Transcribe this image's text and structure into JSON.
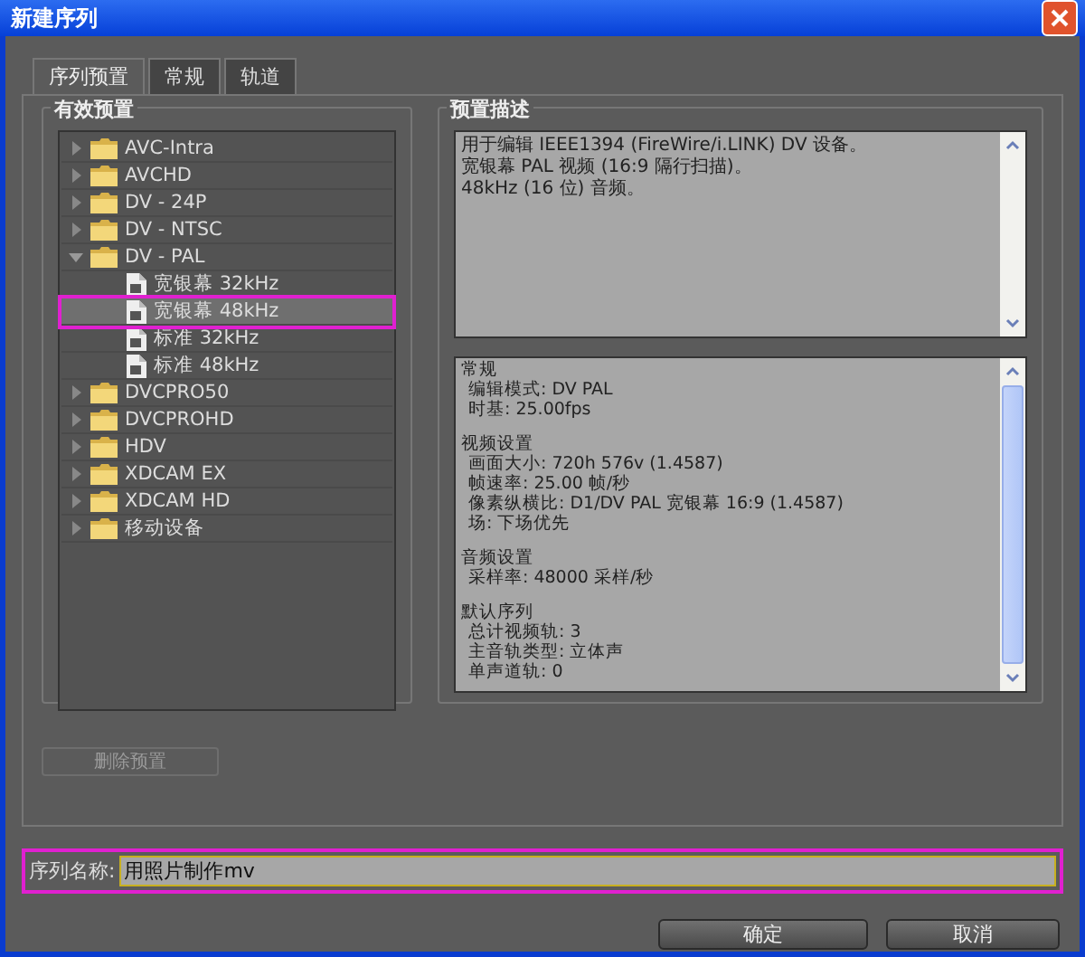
{
  "window": {
    "title": "新建序列"
  },
  "tabs": [
    {
      "label": "序列预置",
      "selected": true
    },
    {
      "label": "常规",
      "selected": false
    },
    {
      "label": "轨道",
      "selected": false
    }
  ],
  "presets": {
    "title": "有效预置",
    "items": [
      {
        "kind": "folder",
        "label": "AVC-Intra",
        "expanded": false,
        "selected": false
      },
      {
        "kind": "folder",
        "label": "AVCHD",
        "expanded": false,
        "selected": false
      },
      {
        "kind": "folder",
        "label": "DV - 24P",
        "expanded": false,
        "selected": false
      },
      {
        "kind": "folder",
        "label": "DV - NTSC",
        "expanded": false,
        "selected": false
      },
      {
        "kind": "folder",
        "label": "DV - PAL",
        "expanded": true,
        "selected": false,
        "children": [
          {
            "kind": "preset",
            "label": "宽银幕 32kHz",
            "selected": false
          },
          {
            "kind": "preset",
            "label": "宽银幕 48kHz",
            "selected": true
          },
          {
            "kind": "preset",
            "label": "标准 32kHz",
            "selected": false
          },
          {
            "kind": "preset",
            "label": "标准 48kHz",
            "selected": false
          }
        ]
      },
      {
        "kind": "folder",
        "label": "DVCPRO50",
        "expanded": false,
        "selected": false
      },
      {
        "kind": "folder",
        "label": "DVCPROHD",
        "expanded": false,
        "selected": false
      },
      {
        "kind": "folder",
        "label": "HDV",
        "expanded": false,
        "selected": false
      },
      {
        "kind": "folder",
        "label": "XDCAM EX",
        "expanded": false,
        "selected": false
      },
      {
        "kind": "folder",
        "label": "XDCAM HD",
        "expanded": false,
        "selected": false
      },
      {
        "kind": "folder",
        "label": "移动设备",
        "expanded": false,
        "selected": false
      }
    ]
  },
  "description": {
    "title": "预置描述",
    "lines": [
      "用于编辑 IEEE1394 (FireWire/i.LINK) DV 设备。",
      "宽银幕 PAL 视频 (16:9 隔行扫描)。",
      "48kHz (16 位) 音频。"
    ]
  },
  "details": [
    {
      "title": "常规",
      "lines": [
        "编辑模式: DV PAL",
        "时基: 25.00fps"
      ]
    },
    {
      "title": "视频设置",
      "lines": [
        "画面大小: 720h 576v (1.4587)",
        "帧速率: 25.00 帧/秒",
        "像素纵横比: D1/DV PAL 宽银幕 16:9 (1.4587)",
        "场: 下场优先"
      ]
    },
    {
      "title": "音频设置",
      "lines": [
        "采样率: 48000 采样/秒"
      ]
    },
    {
      "title": "默认序列",
      "lines": [
        "总计视频轨: 3",
        "主音轨类型: 立体声",
        "单声道轨: 0"
      ]
    }
  ],
  "delete_button": {
    "label": "删除预置",
    "disabled": true
  },
  "sequence_name": {
    "label": "序列名称:",
    "value": "用照片制作mv"
  },
  "buttons": [
    {
      "label": "确定"
    },
    {
      "label": "取消"
    }
  ]
}
